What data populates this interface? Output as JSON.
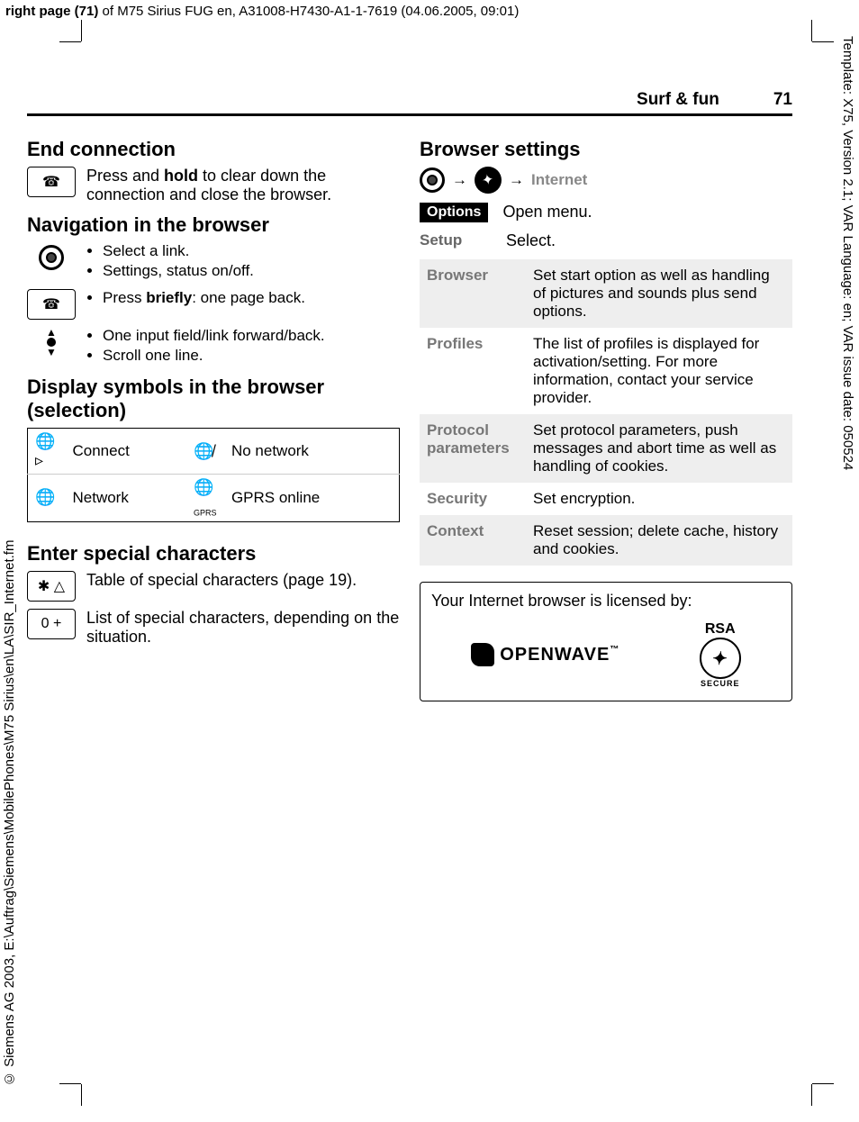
{
  "meta": {
    "top_line_prefix": "right page (71)",
    "top_line_rest": " of M75 Sirius FUG en, A31008-H7430-A1-1-7619 (04.06.2005, 09:01)",
    "right_side": "Template: X75, Version 2.1; VAR Language: en; VAR issue date: 050524",
    "left_side": "© Siemens AG 2003, E:\\Auftrag\\Siemens\\MobilePhones\\M75 Sirius\\en\\LA\\SIR_Internet.fm"
  },
  "header": {
    "section": "Surf & fun",
    "page": "71"
  },
  "left": {
    "end_conn": {
      "title": "End connection",
      "text_parts": [
        "Press and ",
        "hold",
        " to clear down the connection and close the browser."
      ]
    },
    "nav": {
      "title": "Navigation in the browser",
      "r1": [
        "Select a link.",
        "Settings, status on/off."
      ],
      "r2_parts": [
        "Press ",
        "briefly",
        ": one page back."
      ],
      "r3": [
        "One input field/link forward/back.",
        "Scroll one line."
      ]
    },
    "symbols": {
      "title": "Display symbols in the browser (selection)",
      "cells": {
        "a": "Connect",
        "b": "No network",
        "c": "Network",
        "d": "GPRS online",
        "gprs_tag": "GPRS"
      }
    },
    "special": {
      "title": "Enter special characters",
      "r1": "Table of special characters (page 19).",
      "r2": "List of special characters, depending on the situation.",
      "k1": "✱  △",
      "k2": "0  +"
    }
  },
  "right": {
    "title": "Browser settings",
    "nav_label": "Internet",
    "options_tag": "Options",
    "options_text": "Open menu.",
    "setup_k": "Setup",
    "setup_v": "Select.",
    "table": [
      {
        "k": "Browser",
        "v": "Set start option as well as handling of pictures and sounds plus send options."
      },
      {
        "k": "Profiles",
        "v": "The list of profiles is displayed for activation/setting. For more information, contact your service provider."
      },
      {
        "k": "Protocol parameters",
        "v": "Set protocol parameters, push messages and abort time as well as handling of cookies."
      },
      {
        "k": "Security",
        "v": "Set encryption."
      },
      {
        "k": "Context",
        "v": "Reset session; delete cache, history and cookies."
      }
    ],
    "license": {
      "text": "Your Internet browser is licensed by:",
      "logo1": "OPENWAVE",
      "logo2": "RSA",
      "logo2_sub": "SECURE"
    }
  }
}
